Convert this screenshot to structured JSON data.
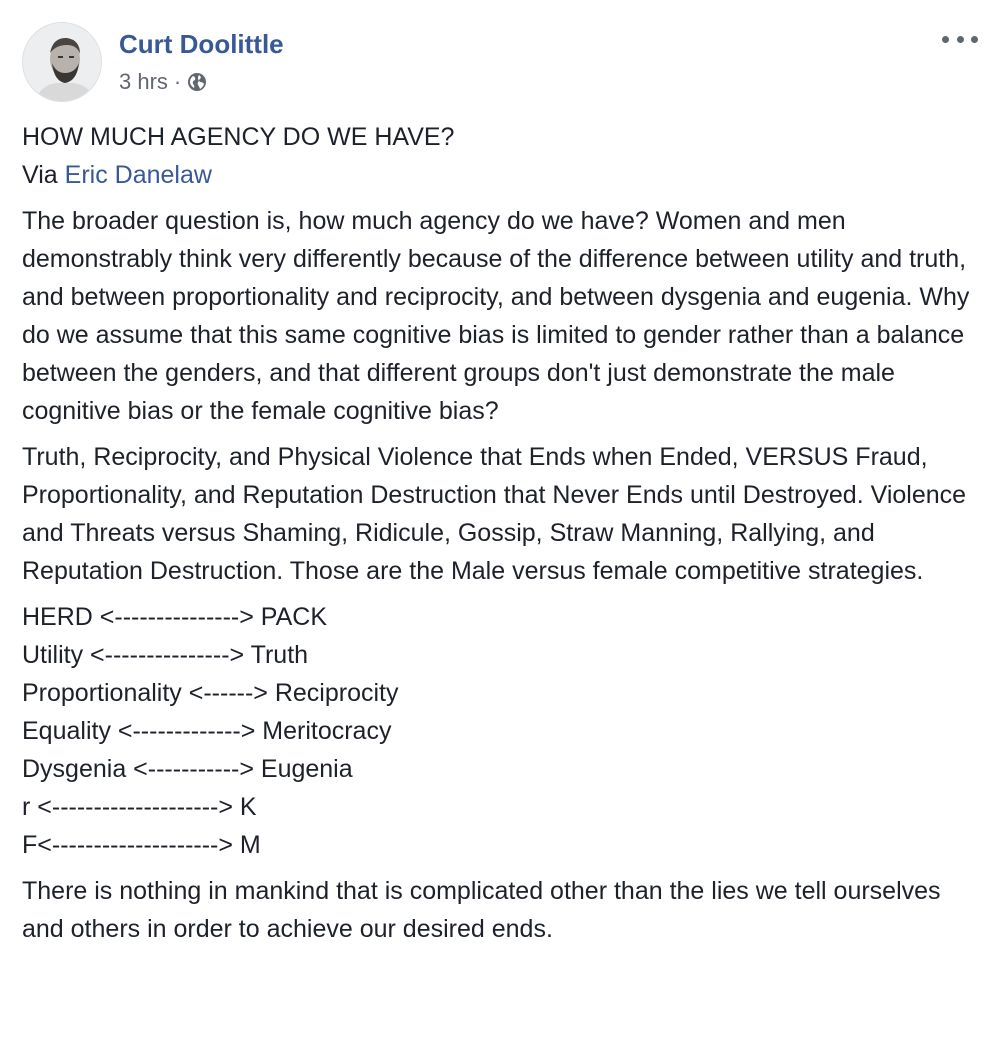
{
  "post": {
    "author_name": "Curt Doolittle",
    "timestamp": "3 hrs",
    "separator": "·",
    "privacy_icon": "globe-icon",
    "more_icon": "ellipsis-icon",
    "title": "HOW MUCH AGENCY DO WE HAVE?",
    "via_prefix": "Via ",
    "via_name": "Eric Danelaw",
    "paragraph_1": "The broader question is, how much agency do we have? Women and men demonstrably think very differently because of the difference between utility and truth, and between proportionality and reciprocity, and between dysgenia and eugenia. Why do we assume that this same cognitive bias is limited to gender rather than a balance between the genders, and that different groups don't just demonstrate the male cognitive bias or the female cognitive bias?",
    "paragraph_2": "Truth, Reciprocity, and Physical Violence that Ends when Ended, VERSUS Fraud, Proportionality, and Reputation Destruction that Never Ends until Destroyed. Violence and Threats versus Shaming, Ridicule, Gossip, Straw Manning, Rallying, and Reputation Destruction. Those are the Male versus female competitive strategies.",
    "pairs": [
      "HERD <---------------> PACK",
      "Utility <---------------> Truth",
      "Proportionality <------> Reciprocity",
      "Equality <-------------> Meritocracy",
      "Dysgenia <-----------> Eugenia",
      "r <--------------------> K",
      "F<--------------------> M"
    ],
    "paragraph_3": "There is nothing in mankind that is complicated other than the lies we tell ourselves and others in order to achieve our desired ends."
  },
  "colors": {
    "link": "#385898",
    "text": "#1d2129",
    "meta": "#616770"
  }
}
